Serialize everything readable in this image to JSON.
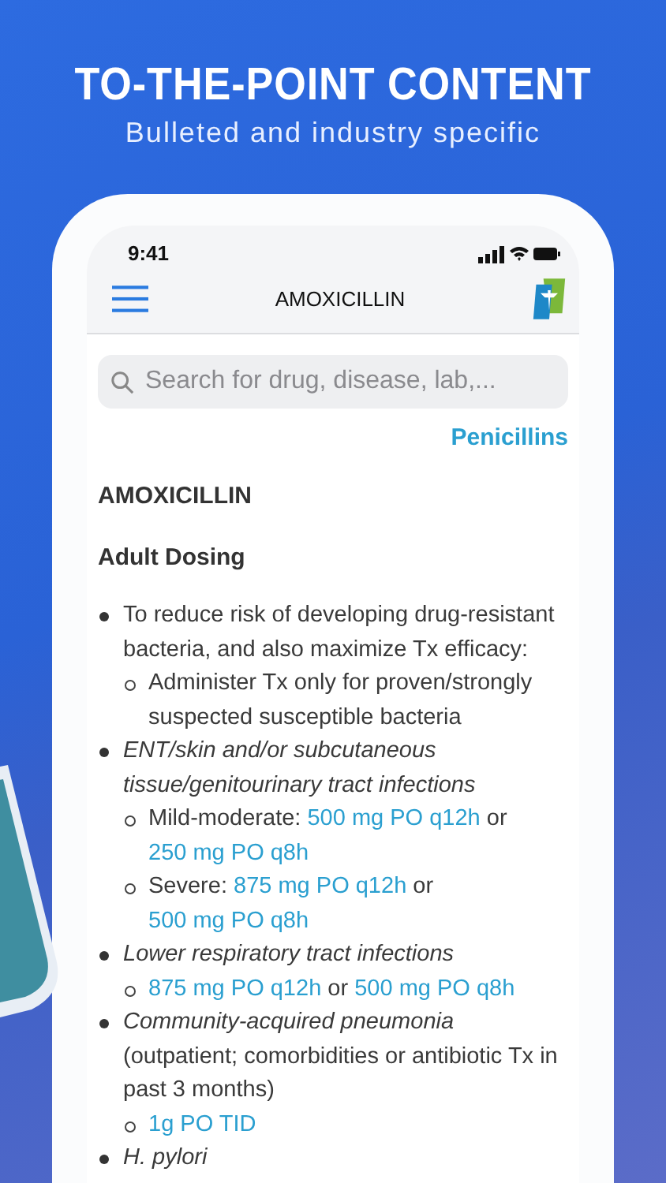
{
  "headline": "TO-THE-POINT CONTENT",
  "subheadline": "Bulleted and industry specific",
  "status_bar": {
    "time": "9:41"
  },
  "nav_bar": {
    "title": "AMOXICILLIN"
  },
  "search": {
    "placeholder": "Search for drug, disease, lab,..."
  },
  "drug_class": "Penicillins",
  "drug_name": "AMOXICILLIN",
  "section_title": "Adult Dosing",
  "bullets": [
    {
      "segments": [
        {
          "kind": "plain",
          "text": "To reduce risk of developing drug-resistant bacteria, and also maximize Tx efficacy:"
        }
      ],
      "children": [
        {
          "segments": [
            {
              "kind": "plain",
              "text": "Administer Tx only for proven/strongly suspected susceptible bacteria"
            }
          ]
        }
      ]
    },
    {
      "segments": [
        {
          "kind": "italic",
          "text": "ENT/skin and/or subcutaneous tissue/genitourinary tract infections"
        }
      ],
      "children": [
        {
          "segments": [
            {
              "kind": "plain",
              "text": "Mild-moderate: "
            },
            {
              "kind": "link",
              "text": "500 mg PO q12h"
            },
            {
              "kind": "plain",
              "text": " or "
            },
            {
              "kind": "link",
              "text": "250 mg PO q8h"
            }
          ]
        },
        {
          "segments": [
            {
              "kind": "plain",
              "text": "Severe: "
            },
            {
              "kind": "link",
              "text": "875 mg PO q12h"
            },
            {
              "kind": "plain",
              "text": " or "
            },
            {
              "kind": "link",
              "text": "500 mg PO q8h"
            }
          ]
        }
      ]
    },
    {
      "segments": [
        {
          "kind": "italic",
          "text": "Lower respiratory tract infections"
        }
      ],
      "children": [
        {
          "segments": [
            {
              "kind": "link",
              "text": "875 mg PO q12h"
            },
            {
              "kind": "plain",
              "text": " or "
            },
            {
              "kind": "link",
              "text": "500 mg PO q8h"
            }
          ]
        }
      ]
    },
    {
      "segments": [
        {
          "kind": "italic",
          "text": "Community-acquired pneumonia"
        },
        {
          "kind": "note",
          "text": "(outpatient; comorbidities or antibiotic Tx in past 3 months)"
        }
      ],
      "children": [
        {
          "segments": [
            {
              "kind": "link",
              "text": "1g PO TID"
            }
          ]
        }
      ]
    },
    {
      "segments": [
        {
          "kind": "italic",
          "text": "H. pylori"
        }
      ]
    }
  ]
}
